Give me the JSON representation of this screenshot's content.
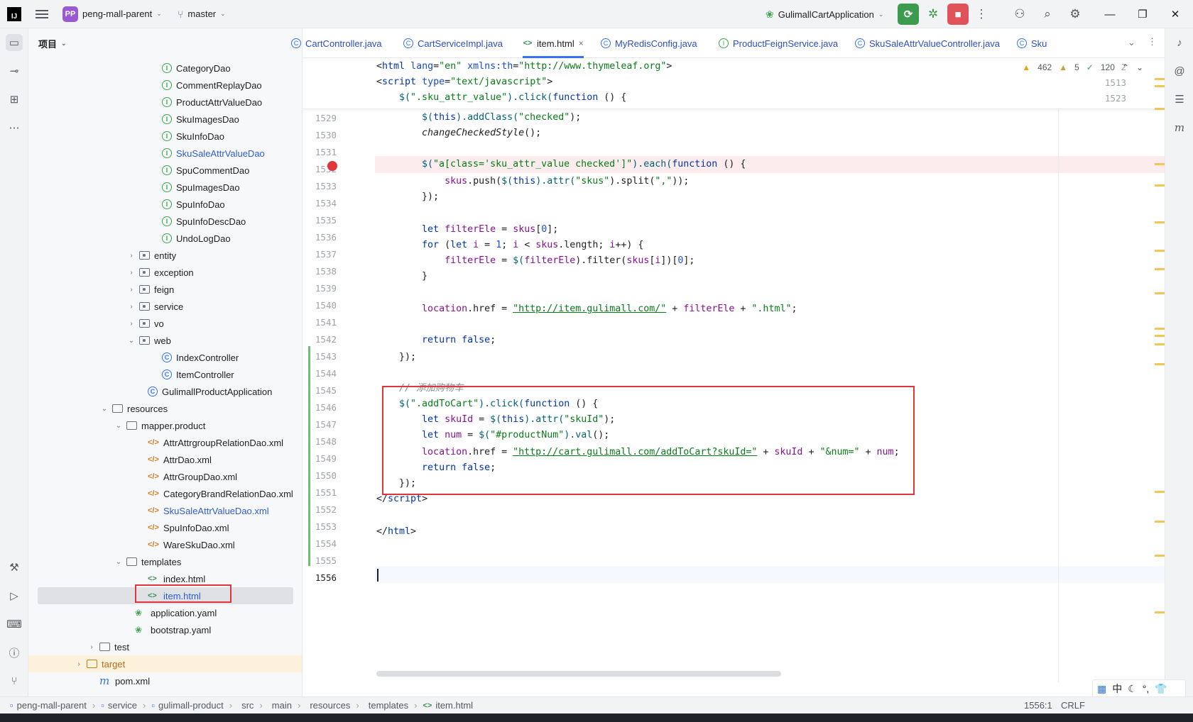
{
  "titlebar": {
    "app_logo": "IJ",
    "project_badge": "PP",
    "project_name": "peng-mall-parent",
    "branch": "master",
    "run_config": "GulimallCartApplication"
  },
  "project_panel": {
    "title": "项目",
    "tree": [
      {
        "label": "CategoryDao",
        "icon": "interface-icon",
        "depth": 9
      },
      {
        "label": "CommentReplayDao",
        "icon": "interface-icon",
        "depth": 9
      },
      {
        "label": "ProductAttrValueDao",
        "icon": "interface-icon",
        "depth": 9
      },
      {
        "label": "SkuImagesDao",
        "icon": "interface-icon",
        "depth": 9
      },
      {
        "label": "SkuInfoDao",
        "icon": "interface-icon",
        "depth": 9
      },
      {
        "label": "SkuSaleAttrValueDao",
        "icon": "interface-icon",
        "depth": 9,
        "modified": true
      },
      {
        "label": "SpuCommentDao",
        "icon": "interface-icon",
        "depth": 9
      },
      {
        "label": "SpuImagesDao",
        "icon": "interface-icon",
        "depth": 9
      },
      {
        "label": "SpuInfoDao",
        "icon": "interface-icon",
        "depth": 9
      },
      {
        "label": "SpuInfoDescDao",
        "icon": "interface-icon",
        "depth": 9
      },
      {
        "label": "UndoLogDao",
        "icon": "interface-icon",
        "depth": 9
      },
      {
        "label": "entity",
        "icon": "package-icon",
        "arrow": "›"
      },
      {
        "label": "exception",
        "icon": "package-icon",
        "arrow": "›"
      },
      {
        "label": "feign",
        "icon": "package-icon",
        "arrow": "›"
      },
      {
        "label": "service",
        "icon": "package-icon",
        "arrow": "›"
      },
      {
        "label": "vo",
        "icon": "package-icon",
        "arrow": "›"
      },
      {
        "label": "web",
        "icon": "package-icon",
        "arrow": "⌄"
      },
      {
        "label": "IndexController",
        "icon": "class-icon"
      },
      {
        "label": "ItemController",
        "icon": "class-icon"
      },
      {
        "label": "GulimallProductApplication",
        "icon": "class-icon"
      },
      {
        "label": "resources",
        "icon": "folder-icon",
        "arrow": "⌄"
      },
      {
        "label": "mapper.product",
        "icon": "folder-icon",
        "arrow": "⌄"
      },
      {
        "label": "AttrAttrgroupRelationDao.xml",
        "icon": "xml-icon"
      },
      {
        "label": "AttrDao.xml",
        "icon": "xml-icon"
      },
      {
        "label": "AttrGroupDao.xml",
        "icon": "xml-icon"
      },
      {
        "label": "CategoryBrandRelationDao.xml",
        "icon": "xml-icon"
      },
      {
        "label": "SkuSaleAttrValueDao.xml",
        "icon": "xml-icon",
        "modified": true
      },
      {
        "label": "SpuInfoDao.xml",
        "icon": "xml-icon"
      },
      {
        "label": "WareSkuDao.xml",
        "icon": "xml-icon"
      },
      {
        "label": "templates",
        "icon": "folder-icon",
        "arrow": "⌄"
      },
      {
        "label": "index.html",
        "icon": "html-icon"
      },
      {
        "label": "item.html",
        "icon": "html-icon",
        "selected": true,
        "modified": true
      },
      {
        "label": "application.yaml",
        "icon": "yaml-icon"
      },
      {
        "label": "bootstrap.yaml",
        "icon": "yaml-icon"
      },
      {
        "label": "test",
        "icon": "folder-icon",
        "arrow": "›"
      },
      {
        "label": "target",
        "icon": "folder-icon",
        "arrow": "›",
        "excluded": true
      },
      {
        "label": "pom.xml",
        "icon": "maven-icon"
      }
    ]
  },
  "tabs": [
    {
      "label": "CartController.java",
      "icon": "class-icon"
    },
    {
      "label": "CartServiceImpl.java",
      "icon": "class-icon"
    },
    {
      "label": "item.html",
      "icon": "html-icon",
      "active": true,
      "close": "×"
    },
    {
      "label": "MyRedisConfig.java",
      "icon": "class-icon"
    },
    {
      "label": "ProductFeignService.java",
      "icon": "interface-icon"
    },
    {
      "label": "SkuSaleAttrValueController.java",
      "icon": "class-icon"
    },
    {
      "label": "Sku",
      "icon": "class-icon"
    }
  ],
  "inspections": {
    "warnings": "462",
    "weak_warnings": "5",
    "typos": "120"
  },
  "editor": {
    "sticky_lines": [
      "2",
      "1513",
      "1523"
    ],
    "line_numbers": [
      "1529",
      "1530",
      "1531",
      "1532",
      "1533",
      "1534",
      "1535",
      "1536",
      "1537",
      "1538",
      "1539",
      "1540",
      "1541",
      "1542",
      "1543",
      "1544",
      "1545",
      "1546",
      "1547",
      "1548",
      "1549",
      "1550",
      "1551",
      "1552",
      "1553",
      "1554",
      "1555",
      "1556"
    ],
    "comment_text": "// 添加购物车",
    "url_item": "\"http://item.gulimall.com/\"",
    "url_cart": "\"http://cart.gulimall.com/addToCart?skuId=\"",
    "cursor_line": "1556:1"
  },
  "statusbar": {
    "crumbs": [
      "peng-mall-parent",
      "service",
      "gulimall-product",
      "src",
      "main",
      "resources",
      "templates",
      "item.html"
    ],
    "position": "1556:1",
    "line_ending": "CRLF"
  },
  "ime": {
    "lang": "中"
  }
}
